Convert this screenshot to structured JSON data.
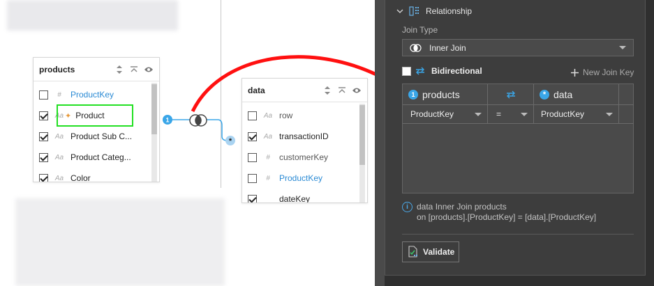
{
  "tables": {
    "products": {
      "title": "products",
      "fields": [
        {
          "type": "#",
          "name": "ProductKey",
          "checked": false
        },
        {
          "type": "Aa",
          "name": "Product",
          "checked": true
        },
        {
          "type": "Aa",
          "name": "Product Sub C...",
          "checked": true
        },
        {
          "type": "Aa",
          "name": "Product Categ...",
          "checked": true
        },
        {
          "type": "Aa",
          "name": "Color",
          "checked": true
        }
      ]
    },
    "data": {
      "title": "data",
      "fields": [
        {
          "type": "Aa",
          "name": "row",
          "checked": false
        },
        {
          "type": "Aa",
          "name": "transactionID",
          "checked": true
        },
        {
          "type": "#",
          "name": "customerKey",
          "checked": false
        },
        {
          "type": "#",
          "name": "ProductKey",
          "checked": false
        },
        {
          "type": "",
          "name": "dateKey",
          "checked": true
        }
      ]
    }
  },
  "connector": {
    "left_badge": "1",
    "right_marker": "*"
  },
  "panel": {
    "section_title": "Relationship",
    "join_type_label": "Join Type",
    "join_type_value": "Inner Join",
    "bidirectional_label": "Bidirectional",
    "new_join_key_label": "New Join Key",
    "grid": {
      "left_badge": "1",
      "left_table": "products",
      "right_badge": "*",
      "right_table": "data",
      "row": {
        "left_key": "ProductKey",
        "operator": "=",
        "right_key": "ProductKey"
      }
    },
    "info_line1": "data Inner Join products",
    "info_line2": "on [products].[ProductKey] = [data].[ProductKey]",
    "validate_label": "Validate"
  },
  "colors": {
    "accent_blue": "#3aa6e8",
    "link_blue": "#2a8ad4",
    "highlight_green": "#22e022",
    "arrow_red": "#ff1010",
    "panel_bg": "#3d3d3d"
  }
}
